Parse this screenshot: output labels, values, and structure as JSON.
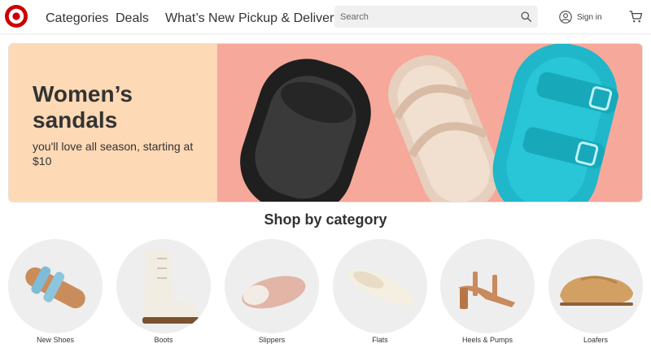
{
  "header": {
    "nav": [
      "Categories",
      "Deals",
      "What’s New",
      "Pickup & Delivery"
    ],
    "search_placeholder": "Search",
    "signin_label": "Sign in",
    "brand_color": "#cc0000"
  },
  "hero": {
    "title": "Women’s sandals",
    "subtitle": "you'll love all season, starting at $10",
    "left_bg": "#fdd9b5",
    "right_bg": "#f6a89b"
  },
  "categories": {
    "title": "Shop by category",
    "items": [
      {
        "label": "New Shoes"
      },
      {
        "label": "Boots"
      },
      {
        "label": "Slippers"
      },
      {
        "label": "Flats"
      },
      {
        "label": "Heels & Pumps"
      },
      {
        "label": "Loafers"
      }
    ]
  },
  "icons": [
    "target-logo-icon",
    "search-icon",
    "account-icon",
    "cart-icon"
  ]
}
